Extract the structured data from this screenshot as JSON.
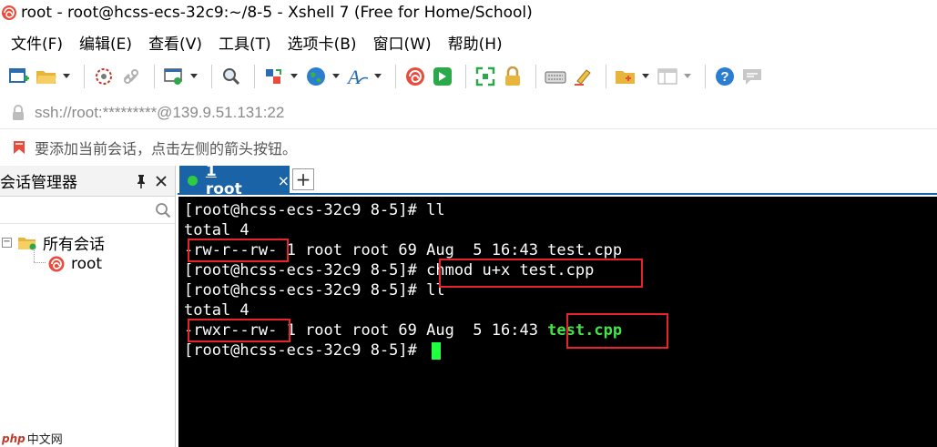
{
  "window": {
    "title": "root - root@hcss-ecs-32c9:~/8-5 - Xshell 7 (Free for Home/School)"
  },
  "menu": [
    {
      "label": "文件(F)"
    },
    {
      "label": "编辑(E)"
    },
    {
      "label": "查看(V)"
    },
    {
      "label": "工具(T)"
    },
    {
      "label": "选项卡(B)"
    },
    {
      "label": "窗口(W)"
    },
    {
      "label": "帮助(H)"
    }
  ],
  "address": {
    "url": "ssh://root:*********@139.9.51.131:22"
  },
  "hint": {
    "text": "要添加当前会话，点击左侧的箭头按钮。"
  },
  "session_manager": {
    "title": "会话管理器",
    "search_placeholder": "",
    "tree": {
      "group_label": "所有会话",
      "session_label": "root"
    }
  },
  "tabs": [
    {
      "label": "1 root",
      "active": true,
      "status_color": "#2ecc40"
    }
  ],
  "terminal": {
    "lines": [
      {
        "prompt": "[root@hcss-ecs-32c9 8-5]# ",
        "text": "ll"
      },
      {
        "text": "total 4"
      },
      {
        "perm": "-rw-r--rw-",
        "rest": " 1 root root 69 Aug  5 16:43 ",
        "file": "test.cpp"
      },
      {
        "prompt": "[root@hcss-ecs-32c9 8-5]# ",
        "text": "chmod u+x test.cpp"
      },
      {
        "prompt": "[root@hcss-ecs-32c9 8-5]# ",
        "text": "ll"
      },
      {
        "text": "total 4"
      },
      {
        "perm": "-rwxr--rw-",
        "rest": " 1 root root 69 Aug  5 16:43 ",
        "file": "test.cpp"
      },
      {
        "prompt": "[root@hcss-ecs-32c9 8-5]# ",
        "text": ""
      }
    ],
    "background": "#000000",
    "executable_color": "#44e34a",
    "highlight_color": "#e8232b"
  },
  "watermark": {
    "brand": "php",
    "text": "中文网"
  }
}
